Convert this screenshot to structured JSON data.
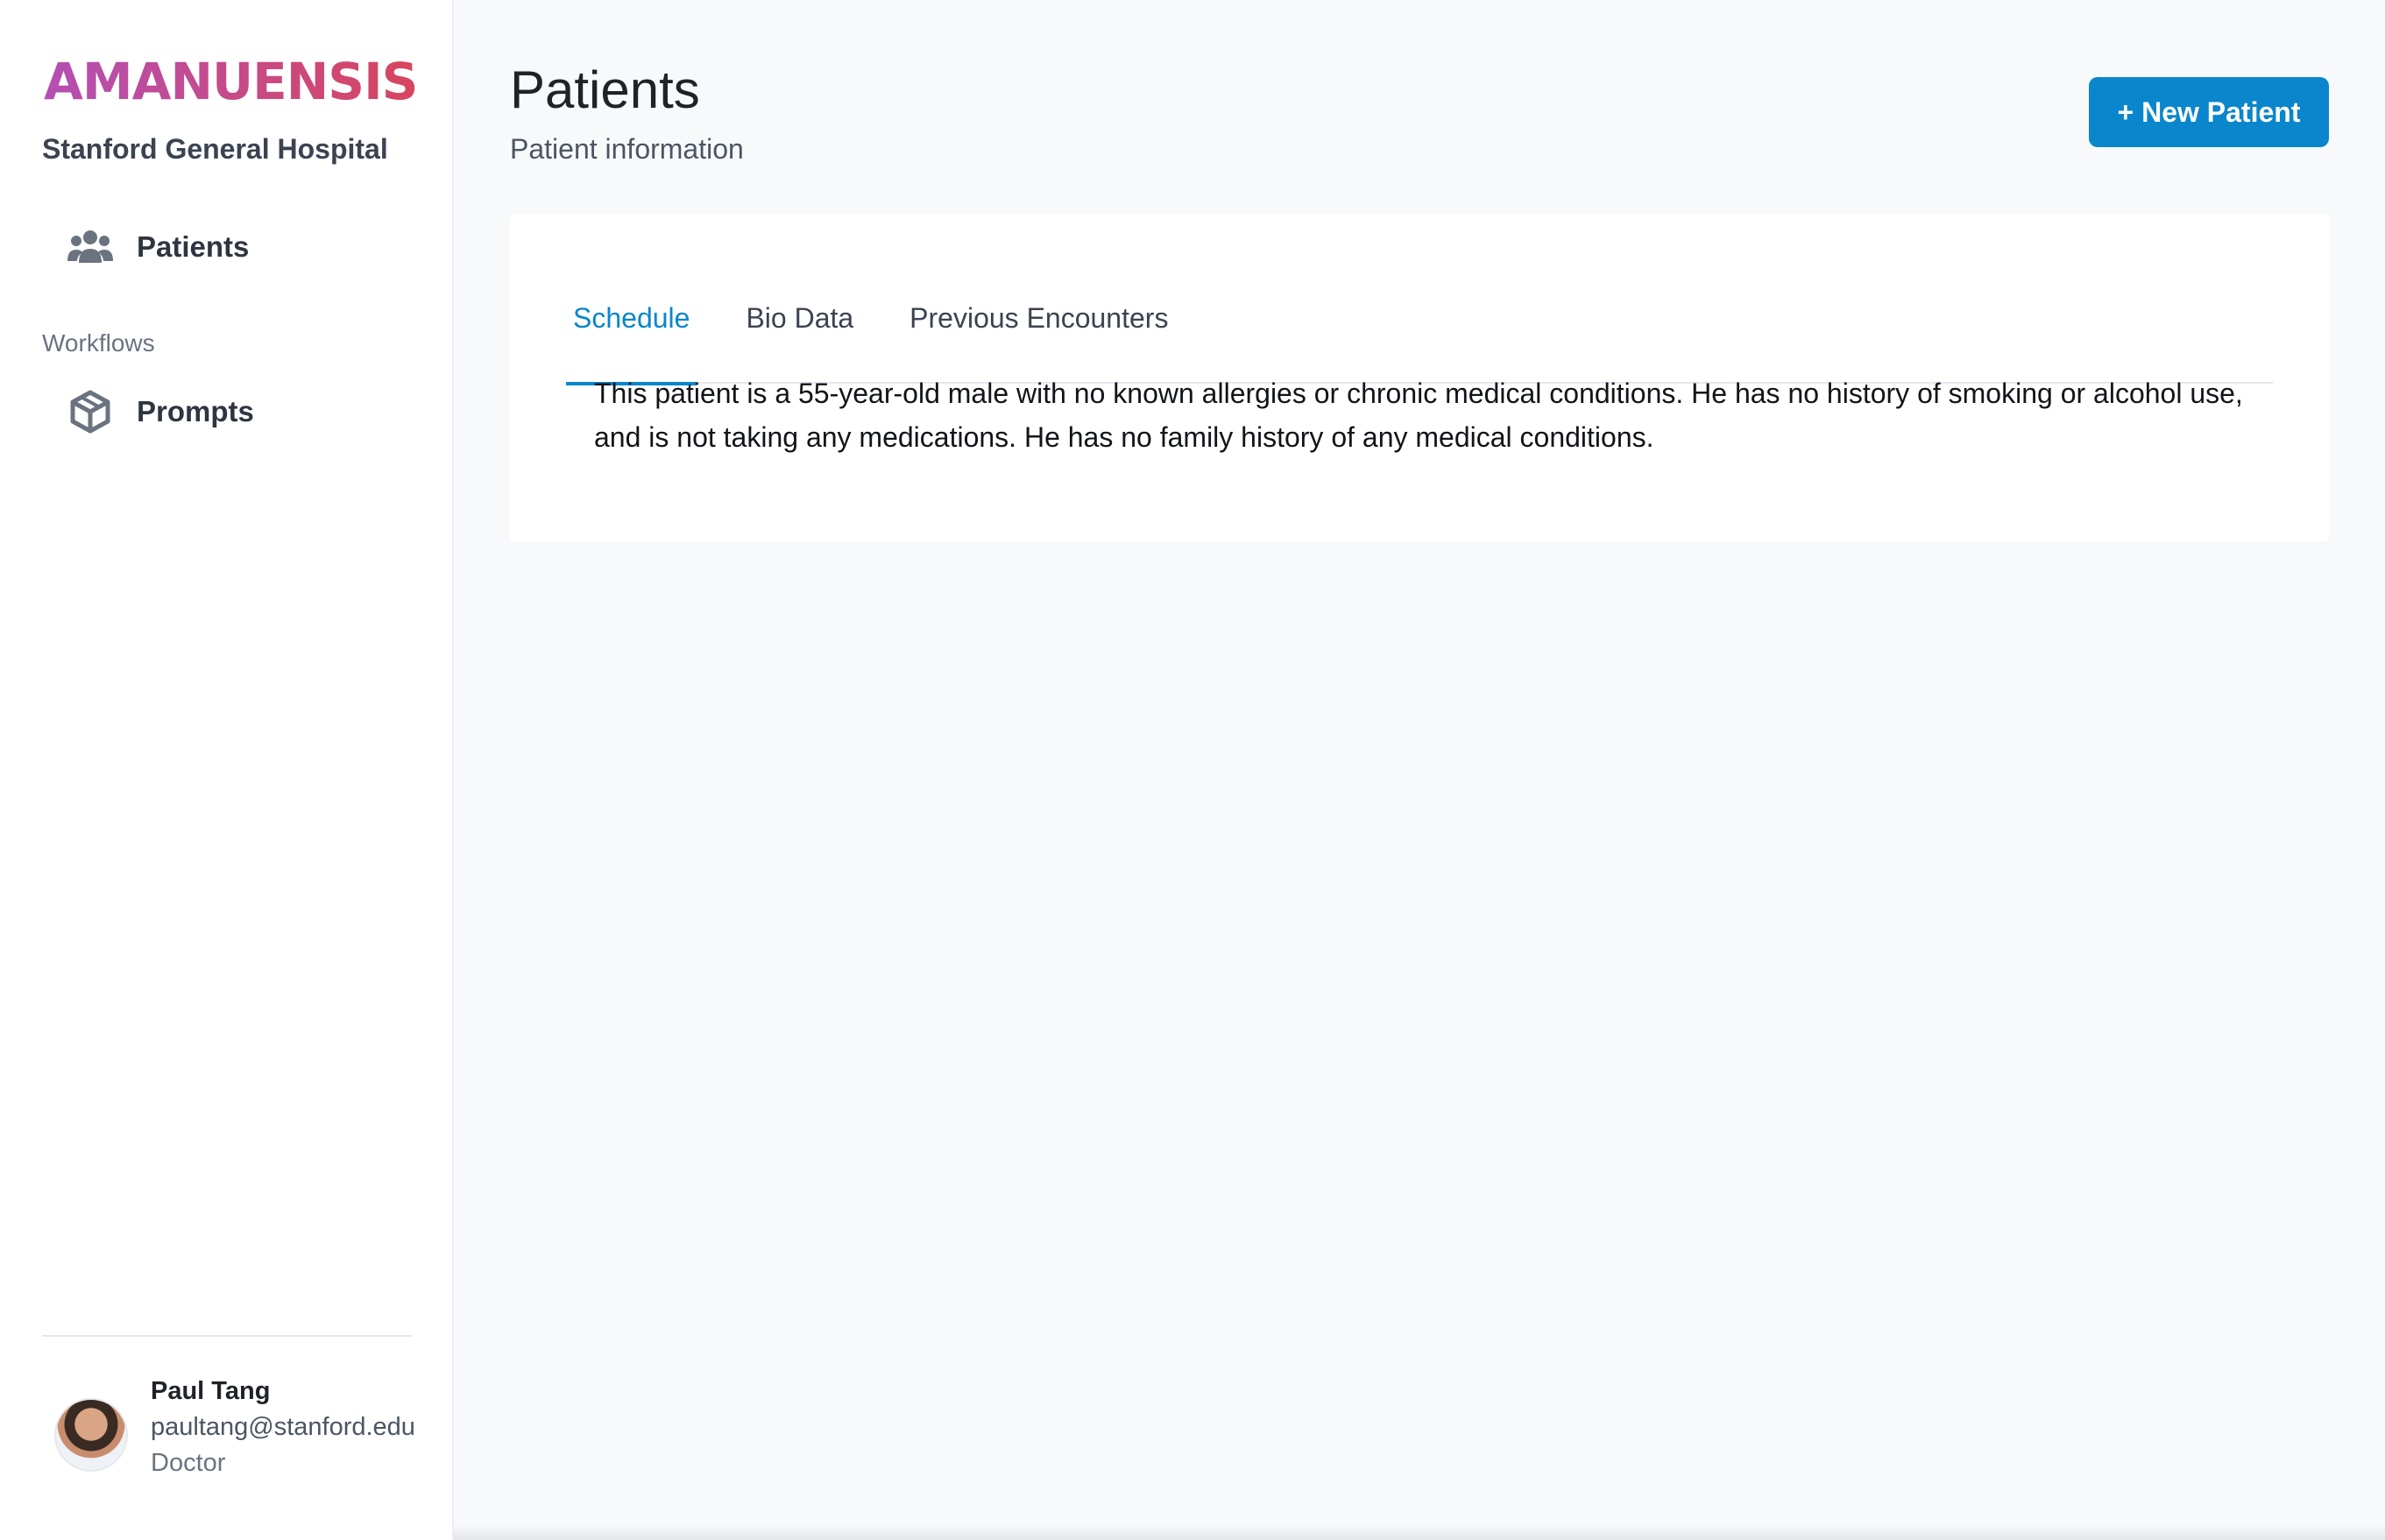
{
  "brand": {
    "name": "AMANUENSIS",
    "organization": "Stanford General Hospital"
  },
  "sidebar": {
    "items": [
      {
        "label": "Patients",
        "icon": "users-icon"
      },
      {
        "label": "Prompts",
        "icon": "cube-icon"
      }
    ],
    "section_label": "Workflows"
  },
  "user": {
    "name": "Paul Tang",
    "email": "paultang@stanford.edu",
    "role": "Doctor"
  },
  "page": {
    "title": "Patients",
    "subtitle": "Patient information",
    "new_button": "+ New Patient"
  },
  "tabs": [
    {
      "label": "Schedule",
      "active": true
    },
    {
      "label": "Bio Data",
      "active": false
    },
    {
      "label": "Previous Encounters",
      "active": false
    }
  ],
  "content": {
    "text": "This patient is a 55-year-old male with no known allergies or chronic medical conditions. He has no history of smoking or alcohol use, and is not taking any medications. He has no family history of any medical conditions."
  },
  "colors": {
    "accent": "#0a86cc",
    "brand_gradient_start": "#b44fb3",
    "brand_gradient_end": "#d8455f"
  }
}
